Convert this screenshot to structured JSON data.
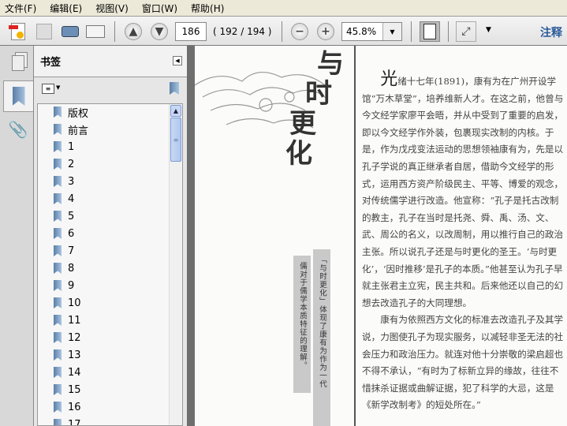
{
  "menu": [
    "文件(F)",
    "编辑(E)",
    "视图(V)",
    "窗口(W)",
    "帮助(H)"
  ],
  "toolbar": {
    "page_number": "186",
    "page_count": "( 192 / 194 )",
    "zoom": "45.8%",
    "comment_label": "注释"
  },
  "panel": {
    "title": "书签",
    "bookmarks": [
      "版权",
      "前言",
      "1",
      "2",
      "3",
      "4",
      "5",
      "6",
      "7",
      "8",
      "9",
      "10",
      "11",
      "12",
      "13",
      "14",
      "15",
      "16",
      "17"
    ]
  },
  "document": {
    "title_chars": [
      "与",
      "时",
      "更",
      "化"
    ],
    "caption_right": "「与时更化」体现了康有为作为一代",
    "caption_left": "儒对于儒学本质特征的理解。",
    "dropcap": "光",
    "para1": "绪十七年(1891)，康有为在广州开设学馆“万木草堂”，培养维新人才。在这之前，他曾与今文经学家廖平会晤，并从中受到了重要的启发，即以今文经学作外装，包裹现实改制的内核。于是，作为戊戌变法运动的思想领袖康有为，先是以孔子学说的真正继承者自居，借助今文经学的形式，运用西方资产阶级民主、平等、博爱的观念，对传统儒学进行改造。他宣称：“孔子是托古改制的教主，孔子在当时是托尧、舜、禹、汤、文、武、周公的名义，以改周制，用以推行自己的政治主张。所以说孔子还是与时更化的圣王。‘与时更化’，‘因时推移’是孔子的本质。”他甚至认为孔子早就主张君主立宪，民主共和。后来他还以自己的幻想去改造孔子的大同理想。",
    "para2": "康有为依照西方文化的标准去改造孔子及其学说，力图使孔子为现实服务，以减轻非圣无法的社会压力和政治压力。就连对他十分崇敬的梁启超也不得不承认，“有时为了标新立异的缘故，往往不惜抹杀证据或曲解证据，犯了科学的大忌，这是《新学改制考》的短处所在。”"
  }
}
